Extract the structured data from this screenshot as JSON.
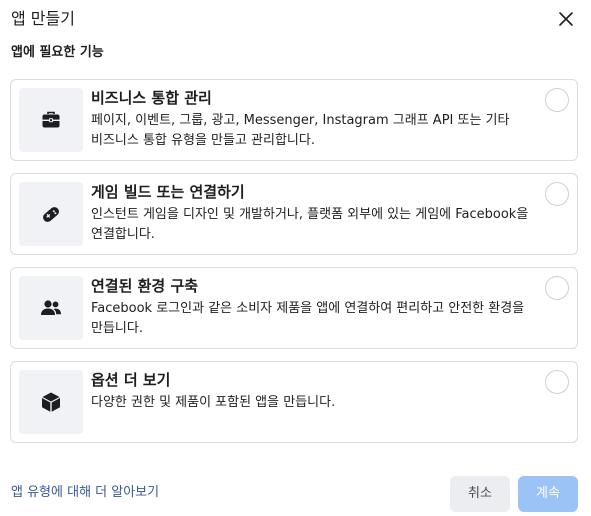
{
  "dialog": {
    "title": "앱 만들기",
    "subtitle": "앱에 필요한 기능"
  },
  "options": [
    {
      "title": "비즈니스 통합 관리",
      "description": "페이지, 이벤트, 그룹, 광고, Messenger, Instagram 그래프 API 또는 기타 비즈니스 통합 유형을 만들고 관리합니다.",
      "icon": "briefcase-icon",
      "selected": false
    },
    {
      "title": "게임 빌드 또는 연결하기",
      "description": "인스턴트 게임을 디자인 및 개발하거나, 플랫폼 외부에 있는 게임에 Facebook을 연결합니다.",
      "icon": "gamepad-icon",
      "selected": false
    },
    {
      "title": "연결된 환경 구축",
      "description": "Facebook 로그인과 같은 소비자 제품을 앱에 연결하여 편리하고 안전한 환경을 만듭니다.",
      "icon": "people-icon",
      "selected": false
    },
    {
      "title": "옵션 더 보기",
      "description": "다양한 권한 및 제품이 포함된 앱을 만듭니다.",
      "icon": "cube-icon",
      "selected": false
    }
  ],
  "footer": {
    "learn_more": "앱 유형에 대해 더 알아보기",
    "cancel_label": "취소",
    "next_label": "계속"
  },
  "colors": {
    "link": "#385898",
    "disabled_primary": "#9cc3f5",
    "icon": "#1c1e21"
  }
}
